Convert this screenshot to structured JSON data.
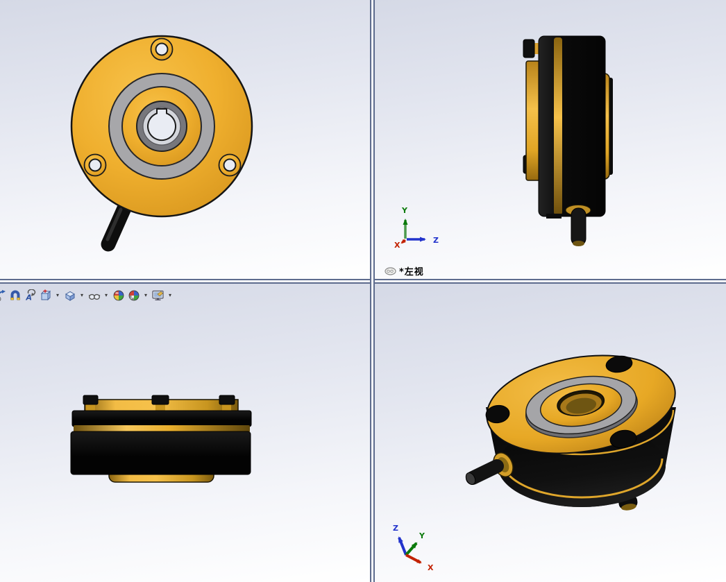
{
  "viewports": {
    "top_right": {
      "view_label": "*左视",
      "axes": {
        "x": "X",
        "y": "Y",
        "z": "Z"
      }
    },
    "bottom_right": {
      "axes": {
        "x": "X",
        "y": "Y",
        "z": "Z"
      }
    }
  },
  "toolbar": {
    "dropdown_glyph": "▾",
    "rotate_glyph": "A",
    "icons": [
      "zoom-to-fit-icon",
      "zoom-to-area-icon",
      "rotate-view-icon",
      "section-view-icon",
      "view-orientation-icon",
      "hide-show-items-icon",
      "apply-scene-icon",
      "view-settings-icon",
      "edit-appearance-icon"
    ]
  },
  "colors": {
    "part_yellow": "#EFAF2E",
    "part_yellow_bright": "#F6C14A",
    "part_yellow_dark": "#A87614",
    "part_black": "#0D0D0D",
    "ring_gray": "#A7A7AA",
    "collar_gray": "#77777C",
    "hole_light": "#E9ECF3",
    "background_top": "#D5D9E6",
    "background_bottom": "#FFFFFF",
    "axis_x": "#C22200",
    "axis_y": "#0B7A0B",
    "axis_z": "#2233CC",
    "splitter_edge": "#5E6C8E"
  }
}
